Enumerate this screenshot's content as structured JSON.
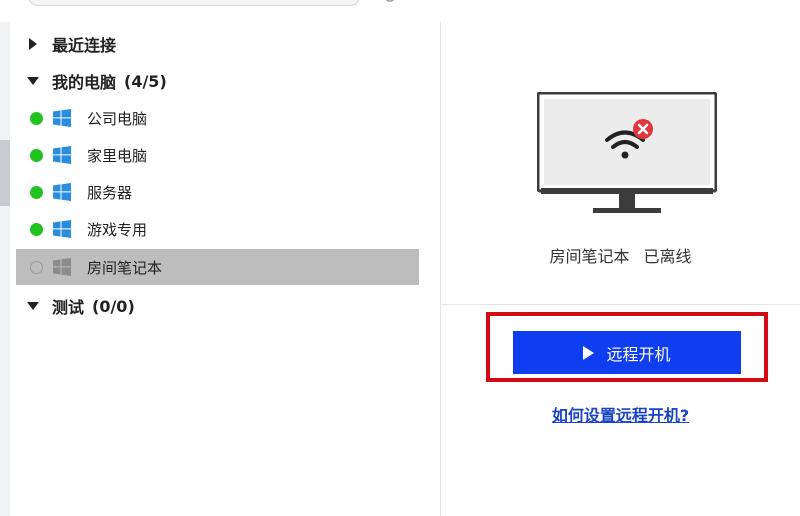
{
  "groups": [
    {
      "label": "最近连接",
      "count": "",
      "expanded": false
    },
    {
      "label": "我的电脑",
      "count": "(4/5)",
      "expanded": true
    },
    {
      "label": "测试",
      "count": "(0/0)",
      "expanded": true
    }
  ],
  "devices": [
    {
      "name": "公司电脑",
      "status": "online"
    },
    {
      "name": "家里电脑",
      "status": "online"
    },
    {
      "name": "服务器",
      "status": "online"
    },
    {
      "name": "游戏专用",
      "status": "online"
    },
    {
      "name": "房间笔记本",
      "status": "offline",
      "selected": true
    }
  ],
  "detail": {
    "device_name": "房间笔记本",
    "status_text": "已离线",
    "wake_button_label": "远程开机",
    "help_link": "如何设置远程开机?"
  },
  "colors": {
    "online": "#22c21f",
    "accent_button": "#0f3df0",
    "highlight_border": "#d20a14",
    "link": "#1a44c8",
    "selected_row": "#bdbdbd",
    "windows_blue": "#2a8ee0"
  },
  "icons": {
    "windows": "windows-icon",
    "monitor": "monitor-icon",
    "wifi_offline": "wifi-offline-icon",
    "play": "play-icon"
  }
}
